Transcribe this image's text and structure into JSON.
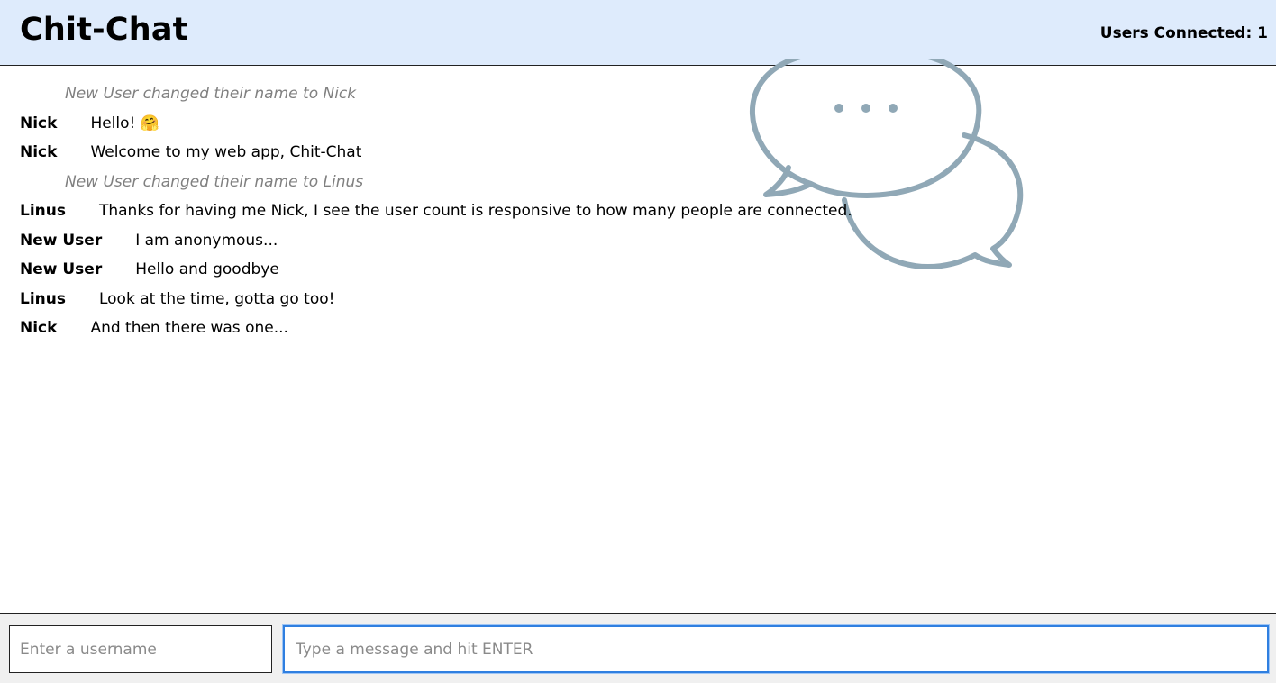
{
  "header": {
    "title": "Chit-Chat",
    "users_connected": "Users Connected: 1"
  },
  "logo": {
    "icon": "chat-bubbles-icon",
    "color": "#90a8b6"
  },
  "messages": [
    {
      "type": "system",
      "text": "New User changed their name to Nick"
    },
    {
      "type": "chat",
      "user": "Nick",
      "text": "Hello! 🤗"
    },
    {
      "type": "chat",
      "user": "Nick",
      "text": "Welcome to my web app, Chit-Chat"
    },
    {
      "type": "system",
      "text": "New User changed their name to Linus"
    },
    {
      "type": "chat",
      "user": "Linus",
      "text": "Thanks for having me Nick, I see the user count is responsive to how many people are connected."
    },
    {
      "type": "chat",
      "user": "New User",
      "text": "I am anonymous..."
    },
    {
      "type": "chat",
      "user": "New User",
      "text": "Hello and goodbye"
    },
    {
      "type": "chat",
      "user": "Linus",
      "text": "Look at the time, gotta go too!"
    },
    {
      "type": "chat",
      "user": "Nick",
      "text": "And then there was one..."
    }
  ],
  "footer": {
    "username_placeholder": "Enter a username",
    "message_placeholder": "Type a message and hit ENTER"
  },
  "colors": {
    "header_bg": "#deebfc",
    "focus_border": "#2f7fe0",
    "system_text": "#808080"
  }
}
